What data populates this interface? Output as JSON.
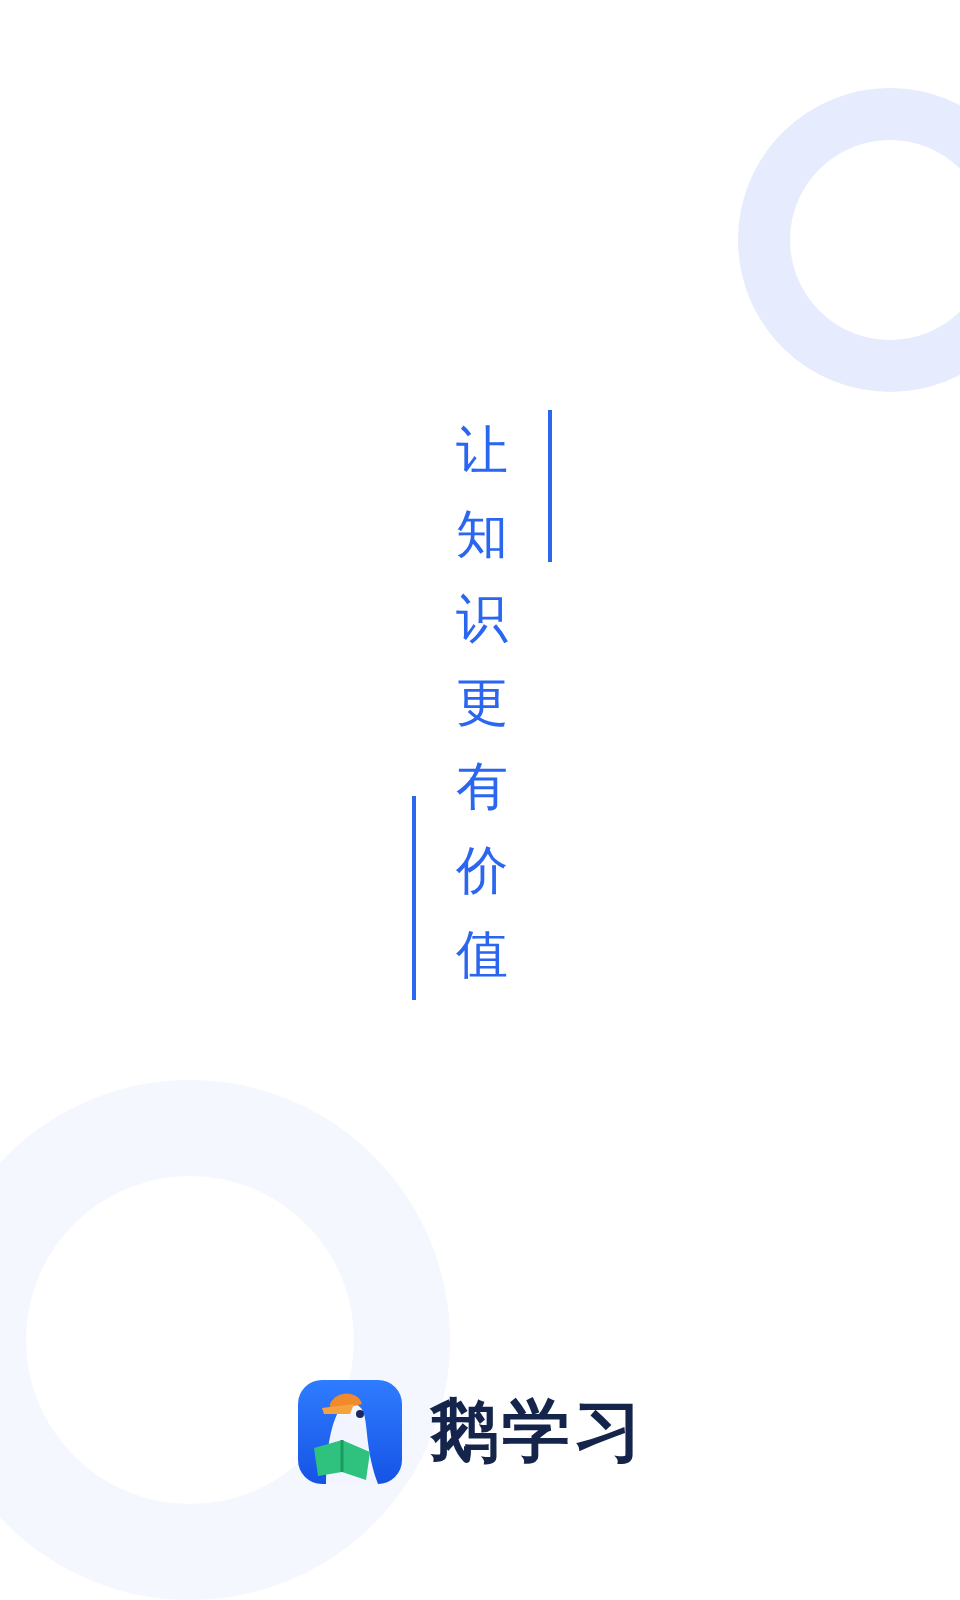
{
  "slogan": "让知识更有价值",
  "brand": {
    "name": "鹅学习"
  }
}
